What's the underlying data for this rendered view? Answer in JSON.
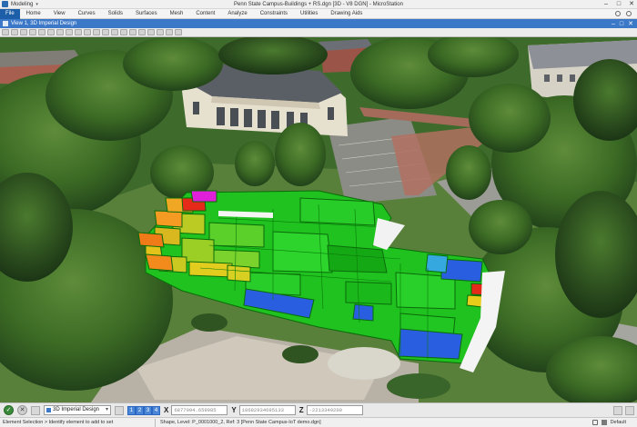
{
  "titlebar": {
    "workspace": "Modeling",
    "document_title": "Penn State Campus-Buildings + RS.dgn [3D - V8 DGN] - MicroStation",
    "minimize": "–",
    "maximize": "□",
    "close": "✕"
  },
  "ribbon": {
    "tabs": [
      "File",
      "Home",
      "View",
      "Curves",
      "Solids",
      "Surfaces",
      "Mesh",
      "Content",
      "Analyze",
      "Constraints",
      "Utilities",
      "Drawing Aids"
    ]
  },
  "view": {
    "title": "View 1, 3D Imperial Design",
    "minimize": "–",
    "maximize": "□",
    "close": "✕"
  },
  "bottombar": {
    "view_select": "3D Imperial Design",
    "view_numbers": [
      "1",
      "2",
      "3",
      "4"
    ],
    "coords": [
      {
        "label": "X",
        "value": "6877094.659985"
      },
      {
        "label": "Y",
        "value": "18682934695133"
      },
      {
        "label": "Z",
        "value": "-2213349200"
      }
    ]
  },
  "statusbar": {
    "prompt": "Element Selection > Identify element to add to set",
    "message": "Shape, Level: P_0001000_2, Ref: 3 [Penn State Campus-IoT demo.dgn]",
    "level": "Default"
  },
  "colors": {
    "accent": "#1c5fa8",
    "view_title": "#3c78c8",
    "room_green": "#1fc21f",
    "room_blue": "#2a5ee0",
    "room_orange": "#f07a18",
    "room_yellow": "#e3c21a",
    "room_magenta": "#e020d8",
    "room_red": "#e52a1a"
  },
  "icons": {
    "workspace": "workspace-icon",
    "view": "view-icon"
  }
}
